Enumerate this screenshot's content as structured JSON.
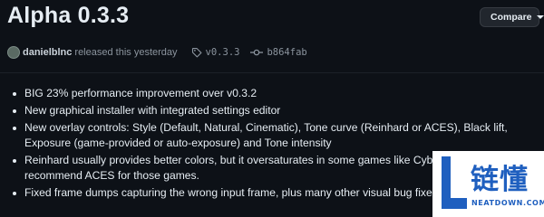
{
  "release": {
    "title": "Alpha 0.3.3",
    "compare_label": "Compare",
    "author": "danielblnc",
    "released_text": "released this yesterday",
    "tag": "v0.3.3",
    "commit": "b864fab"
  },
  "notes": [
    "BIG 23% performance improvement over v0.3.2",
    "New graphical installer with integrated settings editor",
    "New overlay controls: Style (Default, Natural, Cinematic), Tone curve (Reinhard or ACES), Black lift, Exposure (game-provided or auto-exposure) and Tone intensity",
    "Reinhard usually provides better colors, but it oversaturates in some games like Cyberpunk. I recommend ACES for those games.",
    "Fixed frame dumps capturing the wrong input frame, plus many other visual bug fixes"
  ],
  "watermark": {
    "text": "链懂",
    "sub": "NEATDOWN.COM",
    "color": "#1f5fbf"
  },
  "icons": {
    "tag": "tag-icon",
    "commit": "git-commit-icon",
    "dropdown": "caret-down-icon"
  }
}
